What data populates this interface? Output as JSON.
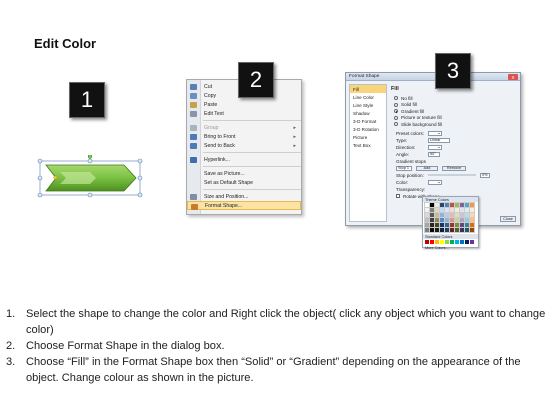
{
  "title": "Edit Color",
  "steps": [
    "1",
    "2",
    "3"
  ],
  "context_menu": {
    "items": [
      {
        "label": "Cut",
        "icon": "scissors-icon",
        "color": "#5b7fb5"
      },
      {
        "label": "Copy",
        "icon": "copy-icon",
        "color": "#6a8fc2"
      },
      {
        "label": "Paste",
        "icon": "paste-icon",
        "color": "#c8a24a"
      },
      {
        "label": "Edit Text",
        "icon": "edit-text-icon",
        "color": "#8895a8"
      },
      {
        "label": "Group",
        "icon": "group-icon",
        "color": "#aab3c0",
        "disabled": true,
        "submenu": true
      },
      {
        "label": "Bring to Front",
        "icon": "bring-front-icon",
        "color": "#4f79b8",
        "submenu": true
      },
      {
        "label": "Send to Back",
        "icon": "send-back-icon",
        "color": "#4f79b8",
        "submenu": true
      },
      {
        "label": "Hyperlink...",
        "icon": "hyperlink-icon",
        "color": "#3d6fb0"
      },
      {
        "label": "Save as Picture...",
        "icon": "",
        "color": ""
      },
      {
        "label": "Set as Default Shape",
        "icon": "",
        "color": ""
      },
      {
        "label": "Size and Position...",
        "icon": "size-icon",
        "color": "#7d8ea6"
      },
      {
        "label": "Format Shape...",
        "icon": "format-icon",
        "color": "#c97a2e",
        "highlighted": true
      }
    ]
  },
  "dialog": {
    "title": "Format Shape",
    "close": "X",
    "nav": [
      "Fill",
      "Line Color",
      "Line Style",
      "Shadow",
      "3-D Format",
      "3-D Rotation",
      "Picture",
      "Text Box"
    ],
    "heading": "Fill",
    "fill_options": [
      "No fill",
      "Solid fill",
      "Gradient fill",
      "Picture or texture fill",
      "Slide background fill"
    ],
    "selected_option": 2,
    "preset_colors": "Preset colors:",
    "type": "Type:",
    "type_value": "Linear",
    "direction": "Direction:",
    "angle": "Angle:",
    "angle_value": "90°",
    "gradient_stops": "Gradient stops",
    "stop_value": "Stop 1",
    "add": "Add",
    "remove": "Remove",
    "stop_position": "Stop position:",
    "stop_position_value": "0%",
    "color": "Color:",
    "transparency": "Transparency:",
    "rotate": "Rotate with shape",
    "close_button": "Close"
  },
  "palette": {
    "theme_colors": "Theme Colors",
    "standard_colors": "Standard Colors",
    "more_colors": "More Colors...",
    "theme": [
      "#ffffff",
      "#000000",
      "#eeece1",
      "#1f497d",
      "#4f81bd",
      "#c0504d",
      "#9bbb59",
      "#8064a2",
      "#4bacc6",
      "#f79646",
      "#f2f2f2",
      "#7f7f7f",
      "#ddd9c3",
      "#c6d9f0",
      "#dbe5f1",
      "#f2dcdb",
      "#ebf1dd",
      "#e5e0ec",
      "#dbeef3",
      "#fdeada",
      "#d8d8d8",
      "#595959",
      "#c4bd97",
      "#8db3e2",
      "#b8cce4",
      "#e5b9b7",
      "#d7e3bc",
      "#ccc1d9",
      "#b7dde8",
      "#fbd5b5",
      "#bfbfbf",
      "#3f3f3f",
      "#938953",
      "#548dd4",
      "#95b3d7",
      "#d99694",
      "#c3d69b",
      "#b2a2c7",
      "#92cddc",
      "#fac08f",
      "#a5a5a5",
      "#262626",
      "#494429",
      "#17365d",
      "#366092",
      "#953734",
      "#76923c",
      "#5f497a",
      "#31859b",
      "#e36c09",
      "#7f7f7f",
      "#0c0c0c",
      "#1d1b10",
      "#0f243e",
      "#244061",
      "#632423",
      "#4f6128",
      "#3f3151",
      "#205867",
      "#974806"
    ],
    "standard": [
      "#c00000",
      "#ff0000",
      "#ffc000",
      "#ffff00",
      "#92d050",
      "#00b050",
      "#00b0f0",
      "#0070c0",
      "#002060",
      "#7030a0"
    ]
  },
  "instructions": [
    {
      "num": "1.",
      "text": "Select the shape to change the color and Right click the object( click any object which you want to change color)"
    },
    {
      "num": "2.",
      "text": "Choose Format Shape in the dialog box."
    },
    {
      "num": "3.",
      "text": "Choose “Fill” in the Format Shape box then “Solid” or “Gradient” depending on the appearance of the object. Change colour as shown in the picture."
    }
  ],
  "colors": {
    "shape_fill": "#7ac142",
    "shape_dark": "#4e8f1f",
    "badge": "#111111",
    "highlight": "#fbe3a3"
  }
}
